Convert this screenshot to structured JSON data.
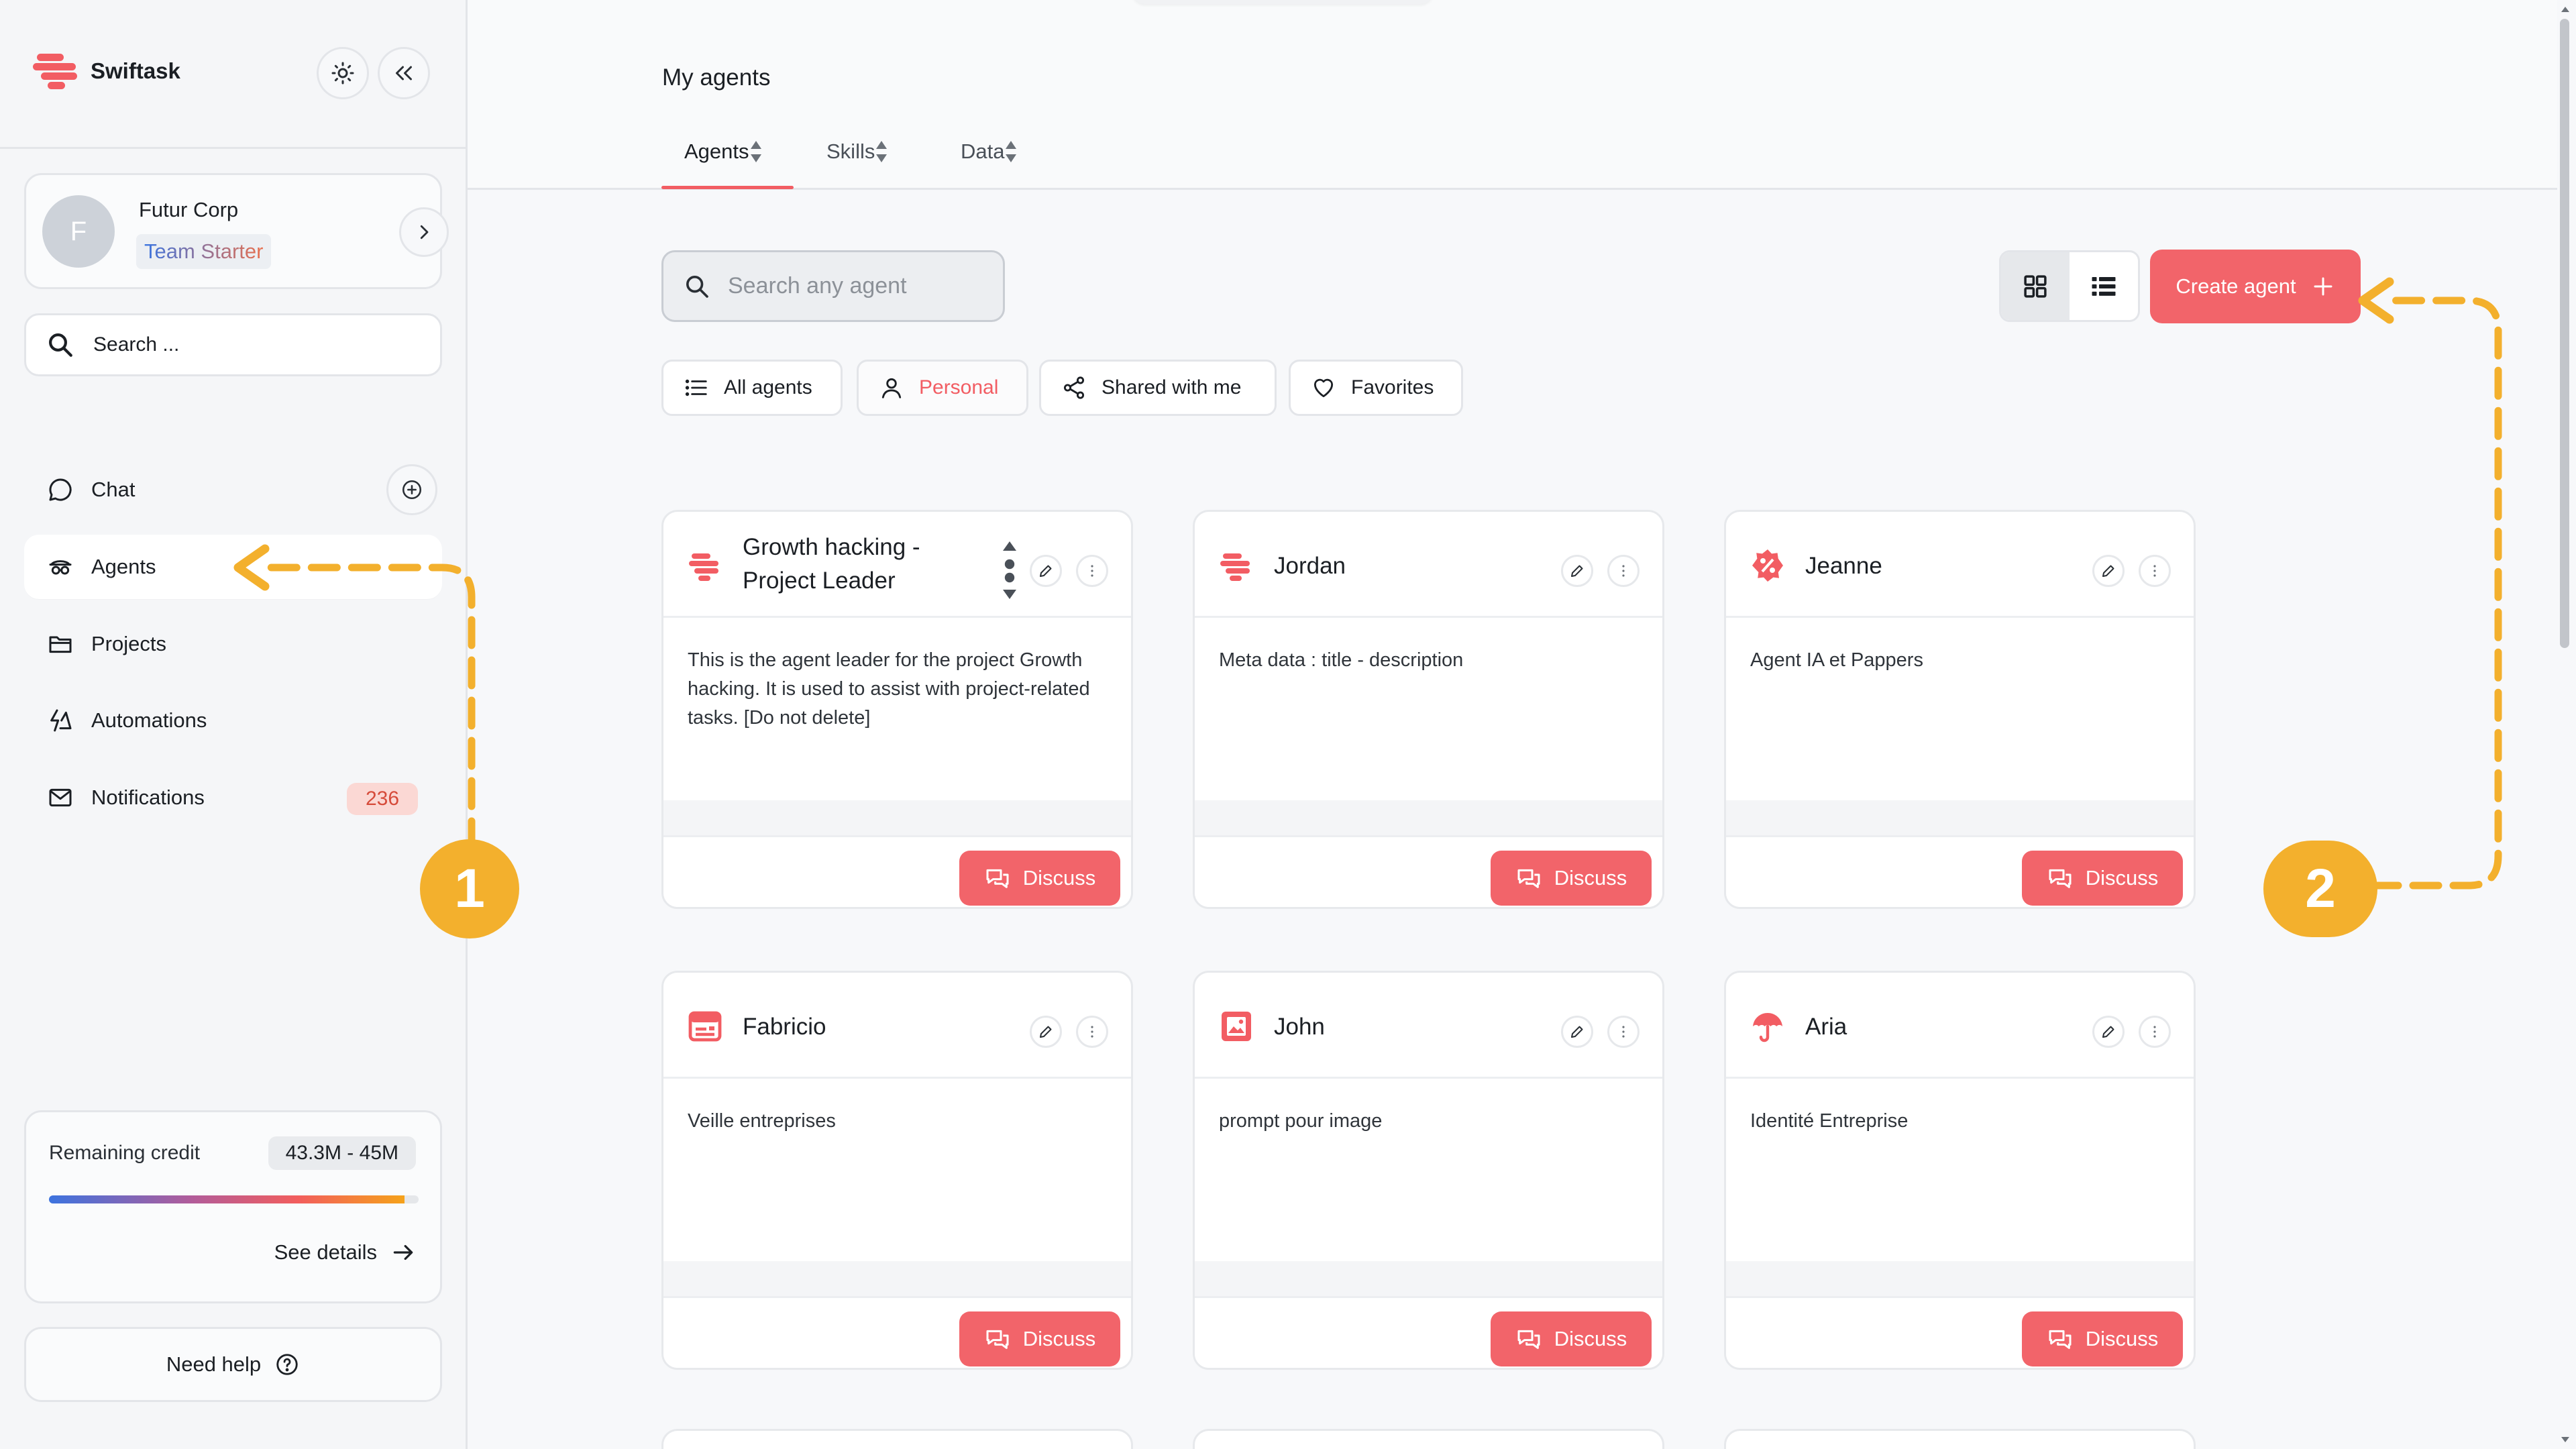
{
  "app": {
    "name": "Swiftask"
  },
  "org": {
    "initial": "F",
    "name": "Futur Corp",
    "plan": "Team Starter"
  },
  "sidebar": {
    "search_label": "Search ...",
    "items": [
      {
        "label": "Chat"
      },
      {
        "label": "Agents"
      },
      {
        "label": "Projects"
      },
      {
        "label": "Automations"
      },
      {
        "label": "Notifications",
        "badge": "236"
      }
    ]
  },
  "credit": {
    "label": "Remaining credit",
    "value": "43.3M - 45M",
    "fraction_remaining": 0.962,
    "details_label": "See details"
  },
  "help": {
    "label": "Need help"
  },
  "page": {
    "title": "My agents",
    "tabs": [
      {
        "label": "Agents"
      },
      {
        "label": "Skills"
      },
      {
        "label": "Data"
      }
    ],
    "search_placeholder": "Search any agent",
    "create_label": "Create agent",
    "filters": [
      {
        "label": "All agents"
      },
      {
        "label": "Personal"
      },
      {
        "label": "Shared with me"
      },
      {
        "label": "Favorites"
      }
    ],
    "discuss_label": "Discuss"
  },
  "agents": [
    {
      "name": "Growth hacking - Project Leader",
      "description": "This is the agent leader for the project Growth hacking. It is used to assist with project-related tasks. [Do not delete]",
      "icon": "swiftask-logo-icon"
    },
    {
      "name": "Jordan",
      "description": "Meta data : title - description",
      "icon": "swiftask-logo-icon"
    },
    {
      "name": "Jeanne",
      "description": "Agent IA et Pappers",
      "icon": "percent-badge-icon"
    },
    {
      "name": "Fabricio",
      "description": "Veille entreprises",
      "icon": "news-screen-icon"
    },
    {
      "name": "John",
      "description": "prompt pour image",
      "icon": "image-file-icon"
    },
    {
      "name": "Aria",
      "description": "Identité Entreprise",
      "icon": "umbrella-icon"
    }
  ],
  "annotations": [
    {
      "label": "1"
    },
    {
      "label": "2"
    }
  ],
  "colors": {
    "accent": "#f2646a",
    "annotation": "#f3b02d"
  }
}
